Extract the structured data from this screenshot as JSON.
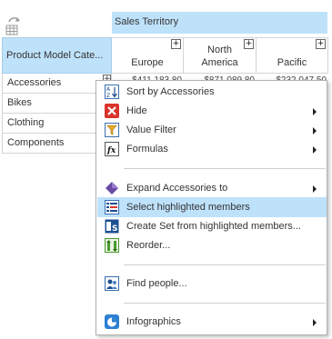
{
  "pivot": {
    "column_field": "Sales Territory",
    "row_field": "Product Model Cate...",
    "expand_symbol": "+",
    "columns": [
      "Europe",
      "North America",
      "Pacific"
    ],
    "rows": [
      "Accessories",
      "Bikes",
      "Clothing",
      "Components"
    ],
    "first_row_cells": [
      "$411,183.80",
      "$871,089.80",
      "$232,047.50"
    ]
  },
  "menu": {
    "sort": "Sort by Accessories",
    "hide": "Hide",
    "value_filter": "Value Filter",
    "formulas": "Formulas",
    "expand_to": "Expand Accessories to",
    "select_highlighted": "Select highlighted members",
    "create_set": "Create Set from highlighted members...",
    "reorder": "Reorder...",
    "find_people": "Find people...",
    "infographics": "Infographics"
  },
  "colors": {
    "header_fill": "#bfe2fb",
    "highlight": "#bfe2fb",
    "menu_border": "#b2b2b2"
  }
}
